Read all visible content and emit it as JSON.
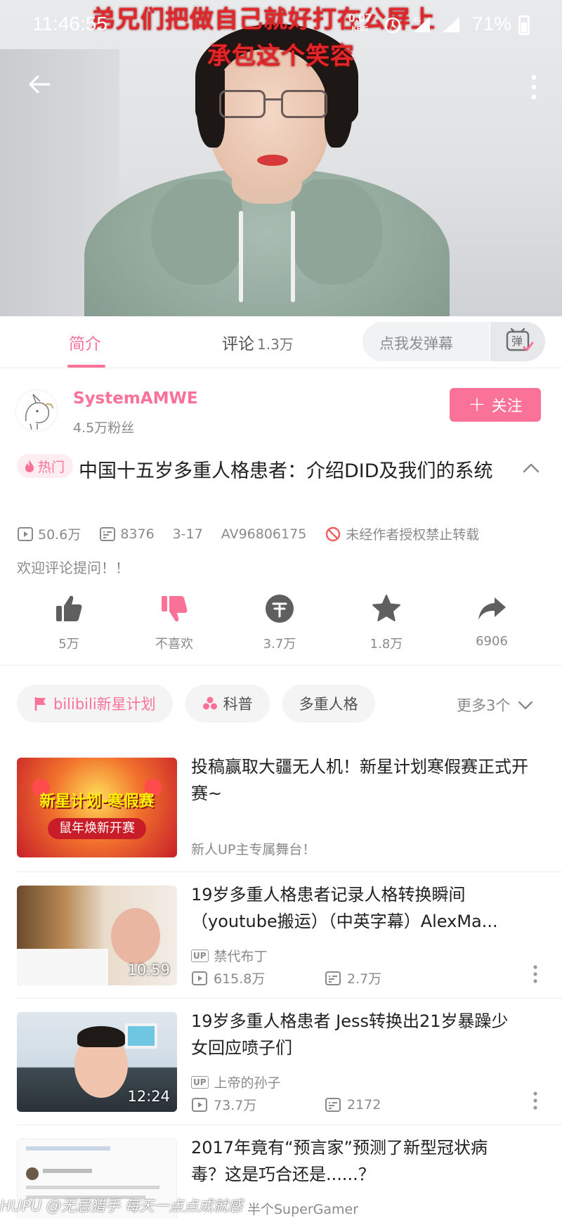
{
  "status_bar": {
    "time": "11:46:55",
    "net_speed": "0.07",
    "net_unit": "KB/S",
    "network": "4G",
    "battery": "71%"
  },
  "video": {
    "danmaku": [
      "弟兄们把做自己就好打在公屏上",
      "承包这个笑容"
    ]
  },
  "tabs": {
    "intro": "简介",
    "comments": "评论",
    "comments_count": "1.3万",
    "danmaku_placeholder": "点我发弹幕",
    "danmaku_toggle": "弹"
  },
  "uploader": {
    "name": "SystemAMWE",
    "fans": "4.5万粉丝",
    "follow_label": "关注"
  },
  "video_info": {
    "hot_tag": "热门",
    "title": "中国十五岁多重人格患者：介绍DID及我们的系统",
    "views": "50.6万",
    "danmaku_count": "8376",
    "date": "3-17",
    "av_id": "AV96806175",
    "copyright_notice": "未经作者授权禁止转载",
    "description": "欢迎评论提问！！"
  },
  "actions": {
    "like": "5万",
    "dislike": "不喜欢",
    "coin": "3.7万",
    "favorite": "1.8万",
    "share": "6906"
  },
  "tags": {
    "items": [
      "bilibili新星计划",
      "科普",
      "多重人格"
    ],
    "more": "更多3个"
  },
  "related": [
    {
      "title": "投稿赢取大疆无人机！新星计划寒假赛正式开赛~",
      "subtitle": "新人UP主专属舞台！",
      "thumb_text_1": "新星计划-寒假赛",
      "thumb_text_2": "鼠年焕新开赛"
    },
    {
      "title_line1": "19岁多重人格患者记录人格转换瞬间",
      "title_line2": "（youtube搬运）（中英字幕）AlexMa...",
      "up_badge": "UP",
      "uploader": "禁代布丁",
      "views": "615.8万",
      "danmaku": "2.7万",
      "duration": "10:59"
    },
    {
      "title_line1": "19岁多重人格患者 Jess转换出21岁暴躁少",
      "title_line2": "女回应喷子们",
      "up_badge": "UP",
      "uploader": "上帝的孙子",
      "views": "73.7万",
      "danmaku": "2172",
      "duration": "12:24"
    },
    {
      "title_line1": "2017年竟有“预言家”预测了新型冠状病",
      "title_line2": "毒？这是巧合还是......？",
      "uploader": "半个SuperGamer"
    }
  ],
  "watermark": "HUPU @无忌猎手  每天一点点成就感",
  "colors": {
    "accent": "#fb7299",
    "text_primary": "#212121",
    "text_secondary": "#8a8a8a",
    "danmaku_red": "#e2262a"
  }
}
